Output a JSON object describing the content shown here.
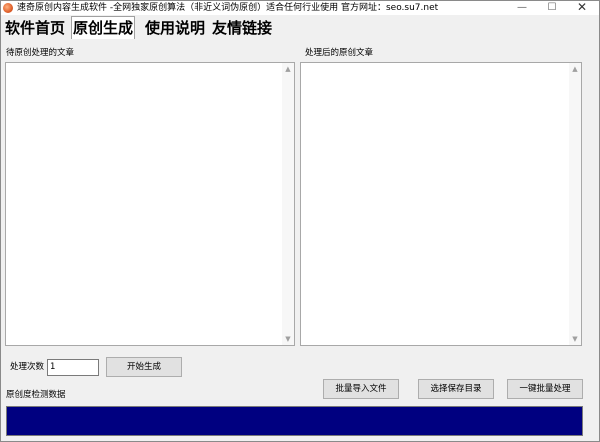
{
  "window": {
    "title": "速奇原创内容生成软件 -全网独家原创算法（非近义词伪原创）适合任何行业使用 官方网址：seo.su7.net",
    "minimize_glyph": "—",
    "maximize_glyph": "☐",
    "close_glyph": "✕"
  },
  "tabs": [
    {
      "label": "软件首页"
    },
    {
      "label": "原创生成"
    },
    {
      "label": "使用说明"
    },
    {
      "label": "友情链接"
    }
  ],
  "main": {
    "input_label": "待原创处理的文章",
    "output_label": "处理后的原创文章",
    "input_text": "",
    "output_text": "",
    "count_label": "处理次数",
    "count_value": "1",
    "start_button": "开始生成",
    "import_button": "批量导入文件",
    "choose_dir_button": "选择保存目录",
    "batch_button": "一键批量处理",
    "detect_label": "原创度检测数据",
    "progress_color": "#000080"
  },
  "icons": {
    "scroll_up": "▲",
    "scroll_down": "▼"
  }
}
